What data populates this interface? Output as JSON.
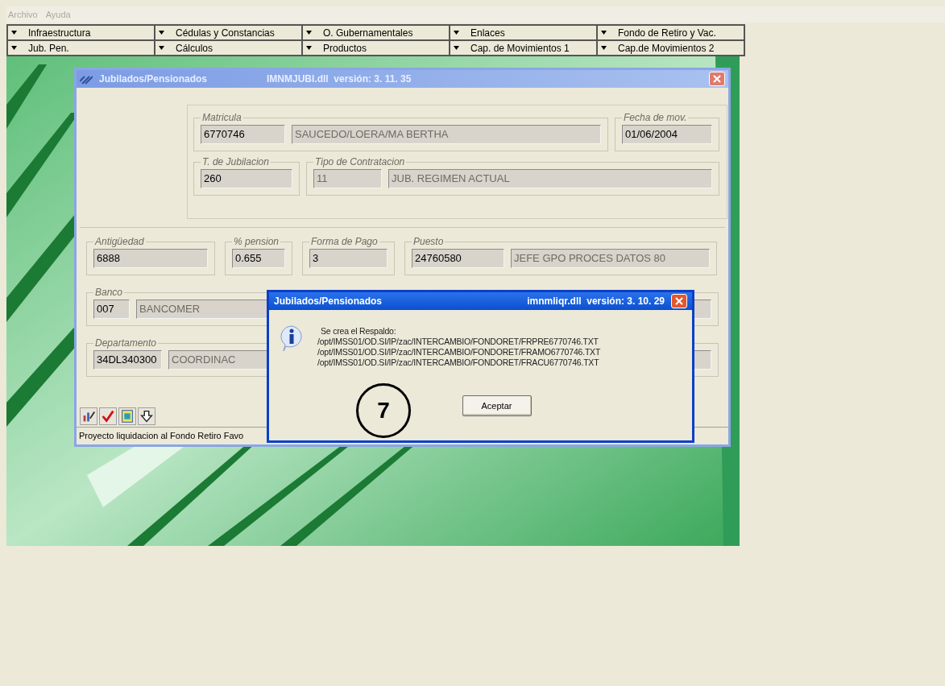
{
  "menu_bar": [
    {
      "label": "Archivo",
      "disabled": true
    },
    {
      "label": "Ayuda",
      "disabled": true
    }
  ],
  "menu_rows": [
    {
      "items": [
        {
          "label": "Infraestructura"
        },
        {
          "label": "Cédulas y Constancias"
        },
        {
          "label": "O. Gubernamentales"
        },
        {
          "label": "Enlaces"
        },
        {
          "label": "Fondo de Retiro y Vac."
        }
      ]
    },
    {
      "items": [
        {
          "label": "Jub. Pen."
        },
        {
          "label": "Cálculos"
        },
        {
          "label": "Productos"
        },
        {
          "label": "Cap. de Movimientos 1"
        },
        {
          "label": "Cap.de Movimientos 2"
        }
      ]
    }
  ],
  "main_window": {
    "title": "Jubilados/Pensionados",
    "subtitle": "IMNMJUBI.dll  versión: 3. 11. 35",
    "top_rows": [
      {
        "groups": [
          {
            "legend": "Matricula",
            "fields": [
              {
                "value": "6770746",
                "disabled": false
              },
              {
                "value": "SAUCEDO/LOERA/MA BERTHA",
                "disabled": true
              }
            ]
          },
          {
            "legend": "Fecha de mov.",
            "fields": [
              {
                "value": "01/06/2004",
                "disabled": false
              }
            ]
          }
        ]
      },
      {
        "groups": [
          {
            "legend": "T. de Jubilacion",
            "fields": [
              {
                "value": "260",
                "disabled": false
              }
            ]
          },
          {
            "legend": "Tipo de Contratacion",
            "fields": [
              {
                "value": "11",
                "disabled": true
              },
              {
                "value": "JUB. REGIMEN ACTUAL",
                "disabled": true
              }
            ]
          }
        ]
      }
    ],
    "bottom_rows": [
      {
        "groups": [
          {
            "legend": "Antigüedad",
            "fields": [
              {
                "value": "6888",
                "disabled": false
              }
            ]
          },
          {
            "legend": "% pension",
            "fields": [
              {
                "value": "0.655",
                "disabled": false
              }
            ]
          },
          {
            "legend": "Forma de Pago",
            "fields": [
              {
                "value": "3",
                "disabled": false
              }
            ]
          },
          {
            "legend": "Puesto",
            "fields": [
              {
                "value": "24760580",
                "disabled": false
              },
              {
                "value": "JEFE GPO PROCES DATOS  80",
                "disabled": true
              }
            ]
          }
        ]
      },
      {
        "groups": [
          {
            "legend": "Banco",
            "fields": [
              {
                "value": "007",
                "disabled": false
              },
              {
                "value": "BANCOMER",
                "disabled": true
              }
            ]
          }
        ]
      },
      {
        "groups": [
          {
            "legend": "Departamento",
            "fields": [
              {
                "value": "34DL340300",
                "disabled": false
              },
              {
                "value": "COORDINAC",
                "disabled": true
              }
            ]
          }
        ]
      }
    ],
    "status_bar": "Proyecto liquidacion al Fondo Retiro Favo"
  },
  "dialog": {
    "title": "Jubilados/Pensionados",
    "subtitle": "imnmliqr.dll  versión: 3. 10. 29",
    "message": [
      "Se crea el Respaldo:",
      "/opt/IMSS01/OD.SI/IP/zac/INTERCAMBIO/FONDORET/FRPRE6770746.TXT",
      "/opt/IMSS01/OD.SI/IP/zac/INTERCAMBIO/FONDORET/FRAMO6770746.TXT",
      "/opt/IMSS01/OD.SI/IP/zac/INTERCAMBIO/FONDORET/FRACU6770746.TXT"
    ],
    "button": "Aceptar"
  },
  "annotation": "7"
}
